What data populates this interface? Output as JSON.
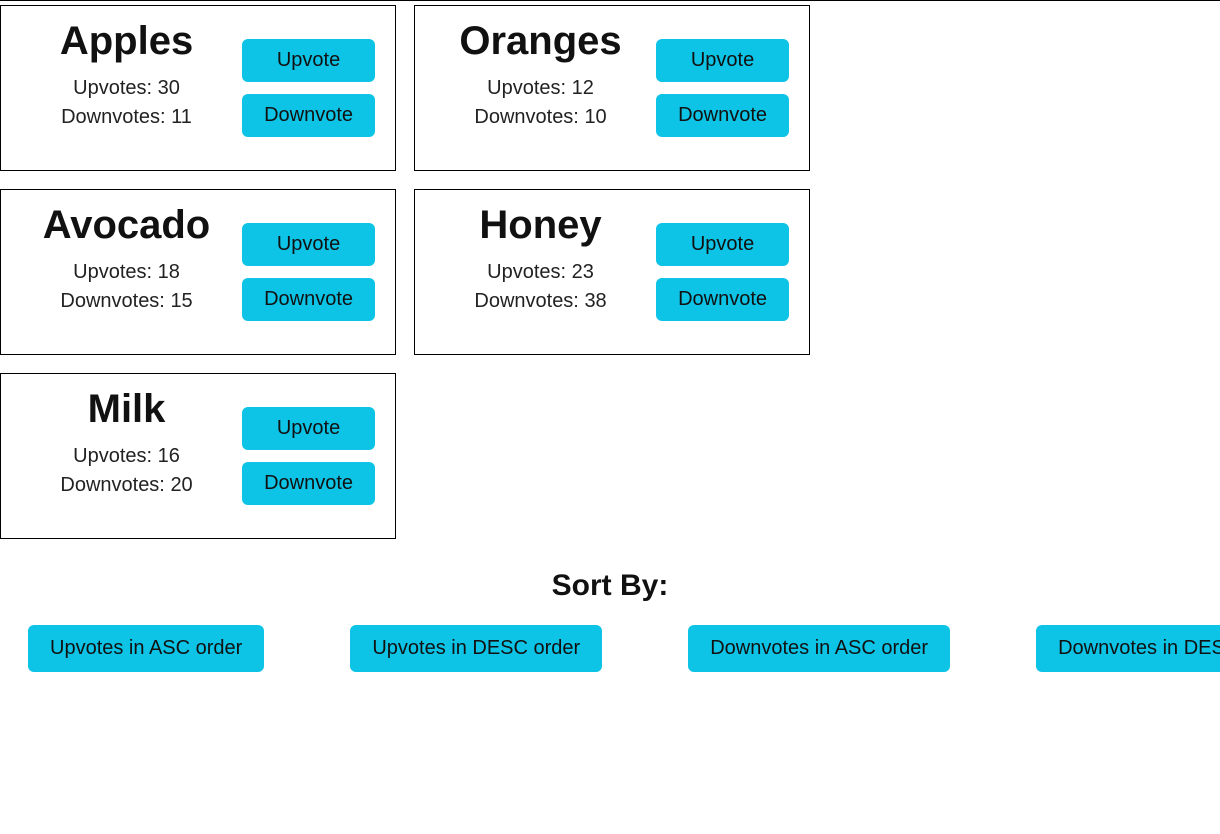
{
  "labels": {
    "upvote": "Upvote",
    "downvote": "Downvote",
    "upvotes_prefix": "Upvotes: ",
    "downvotes_prefix": "Downvotes: "
  },
  "items": [
    {
      "name": "Apples",
      "upvotes": 30,
      "downvotes": 11
    },
    {
      "name": "Oranges",
      "upvotes": 12,
      "downvotes": 10
    },
    {
      "name": "Avocado",
      "upvotes": 18,
      "downvotes": 15
    },
    {
      "name": "Honey",
      "upvotes": 23,
      "downvotes": 38
    },
    {
      "name": "Milk",
      "upvotes": 16,
      "downvotes": 20
    }
  ],
  "sort": {
    "title": "Sort By:",
    "buttons": [
      "Upvotes in ASC order",
      "Upvotes in DESC order",
      "Downvotes in ASC order",
      "Downvotes in DESC order"
    ]
  }
}
